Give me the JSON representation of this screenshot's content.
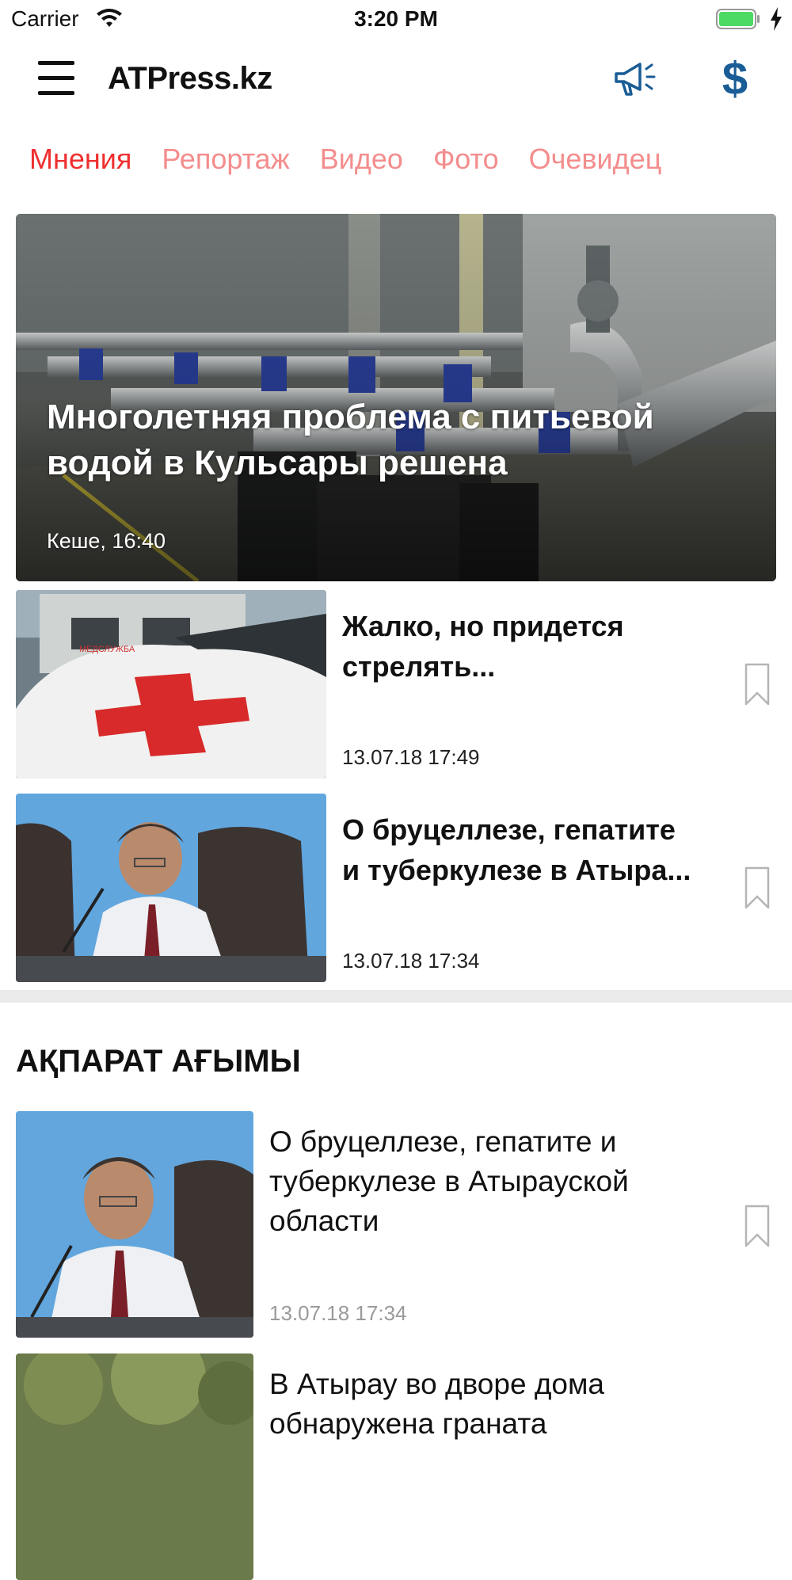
{
  "status_bar": {
    "carrier": "Carrier",
    "time": "3:20 PM",
    "battery_color": "#4cd964"
  },
  "nav": {
    "title": "ATPress.kz",
    "icons": [
      "menu-icon",
      "megaphone-icon",
      "dollar-icon"
    ],
    "accent_color": "#1a5c96"
  },
  "tabs": [
    {
      "label": "Мнения",
      "active": true
    },
    {
      "label": "Репортаж",
      "active": false
    },
    {
      "label": "Видео",
      "active": false
    },
    {
      "label": "Фото",
      "active": false
    },
    {
      "label": "Очевидец",
      "active": false
    }
  ],
  "hero": {
    "title": "Многолетняя проблема с питьевой водой в Кульсары решена",
    "time": "Кеше, 16:40"
  },
  "top_news": [
    {
      "title": "Жалко, но придется\nстрелять...",
      "time": "13.07.18 17:49"
    },
    {
      "title": "О бруцеллезе, гепатите\nи туберкулезе в Атыра...",
      "time": "13.07.18 17:34"
    }
  ],
  "feed": {
    "title": "АҚПАРАТ АҒЫМЫ",
    "items": [
      {
        "title": "О бруцеллезе, гепатите и\nтуберкулезе в Атырауской\nобласти",
        "time": "13.07.18 17:34"
      },
      {
        "title": "В Атырау во дворе дома\nобнаружена граната",
        "time": ""
      }
    ]
  }
}
